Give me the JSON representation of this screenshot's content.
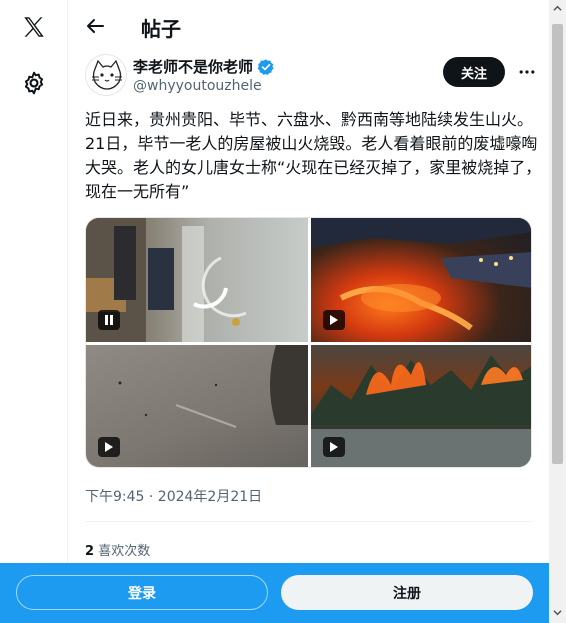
{
  "header": {
    "title": "帖子"
  },
  "post": {
    "author_name": "李老师不是你老师",
    "handle": "@whyyoutouzhele",
    "follow_label": "关注",
    "text": "近日来，贵州贵阳、毕节、六盘水、黔西南等地陆续发生山火。21日，毕节一老人的房屋被山火烧毁。老人看着眼前的废墟嚎啕大哭。老人的女儿唐女士称“火现在已经灭掉了，家里被烧掉了，现在一无所有”",
    "timestamp": "下午9:45 · 2024年2月21日",
    "likes_count": "2",
    "likes_label": "喜欢次数"
  },
  "media": [
    {
      "icon": "pause-icon"
    },
    {
      "icon": "play-icon"
    },
    {
      "icon": "play-icon"
    },
    {
      "icon": "play-icon"
    }
  ],
  "bottom_bar": {
    "login_label": "登录",
    "signup_label": "注册"
  },
  "colors": {
    "accent": "#1d9bf0",
    "text": "#0f1419",
    "muted": "#536471",
    "verified": "#1d9bf0"
  }
}
